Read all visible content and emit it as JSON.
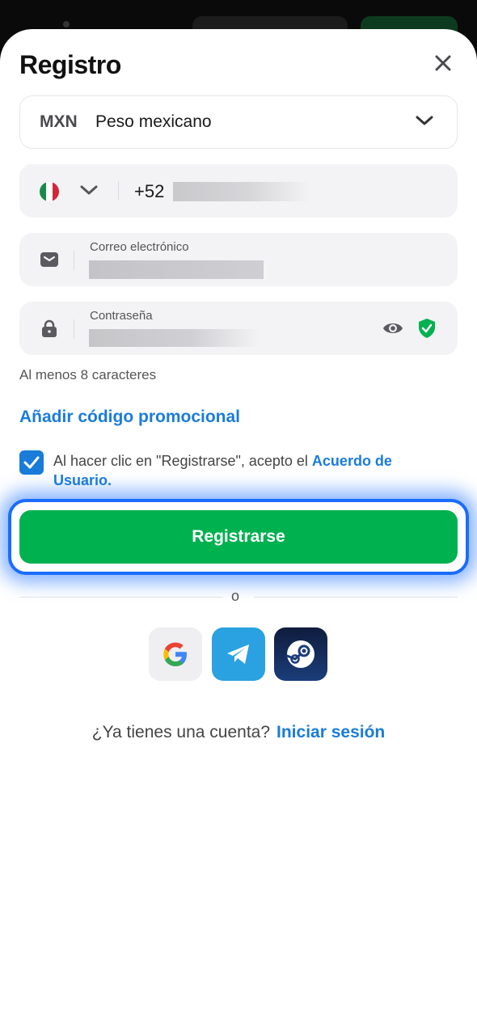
{
  "header": {
    "title": "Registro"
  },
  "currency": {
    "code": "MXN",
    "name": "Peso mexicano"
  },
  "phone": {
    "prefix": "+52"
  },
  "email": {
    "label": "Correo electrónico"
  },
  "password": {
    "label": "Contraseña",
    "hint": "Al menos 8 caracteres"
  },
  "promo": {
    "label": "Añadir código promocional"
  },
  "terms": {
    "checked": true,
    "text": "Al hacer clic en \"Registrarse\", acepto el ",
    "link": "Acuerdo de Usuario",
    "end": "."
  },
  "submit": {
    "label": "Registrarse"
  },
  "divider": {
    "label": "o"
  },
  "social": {
    "icons": [
      "google-icon",
      "telegram-icon",
      "steam-icon"
    ]
  },
  "signin": {
    "question": "¿Ya tienes una cuenta?",
    "link": "Iniciar sesión"
  },
  "colors": {
    "accent": "#1a7cd9",
    "primary_button": "#00b14f",
    "focus_ring": "#1a6cff"
  }
}
